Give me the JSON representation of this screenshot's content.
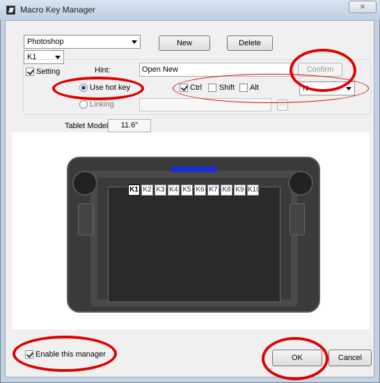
{
  "window": {
    "title": "Macro Key Manager",
    "close_glyph": "⨯"
  },
  "profile": {
    "selected": "Photoshop",
    "key_selected": "K1"
  },
  "buttons": {
    "new": "New",
    "delete": "Delete",
    "confirm": "Confirm",
    "ok": "OK",
    "cancel": "Cancel"
  },
  "setting": {
    "label": "Setting",
    "checked": true,
    "hint_label": "Hint:",
    "hint_value": "Open New"
  },
  "mode": {
    "hotkey_label": "Use hot key",
    "linking_label": "Linking",
    "selected": "hotkey"
  },
  "modifiers": {
    "ctrl": "Ctrl",
    "shift": "Shift",
    "alt": "Alt",
    "ctrl_checked": true,
    "shift_checked": false,
    "alt_checked": false
  },
  "key_combo": {
    "value": "N"
  },
  "linking": {
    "browse": "..."
  },
  "tablet": {
    "model_label": "Tablet Model:",
    "model_value": "11.6\"",
    "keys": [
      "K1",
      "K2",
      "K3",
      "K4",
      "K5",
      "K6",
      "K7",
      "K8",
      "K9",
      "K10"
    ],
    "selected_key": "K1"
  },
  "footer": {
    "enable_label": "Enable this manager",
    "enable_checked": true
  },
  "colors": {
    "annotation": "#e00000",
    "led": "#1a2bd6"
  }
}
